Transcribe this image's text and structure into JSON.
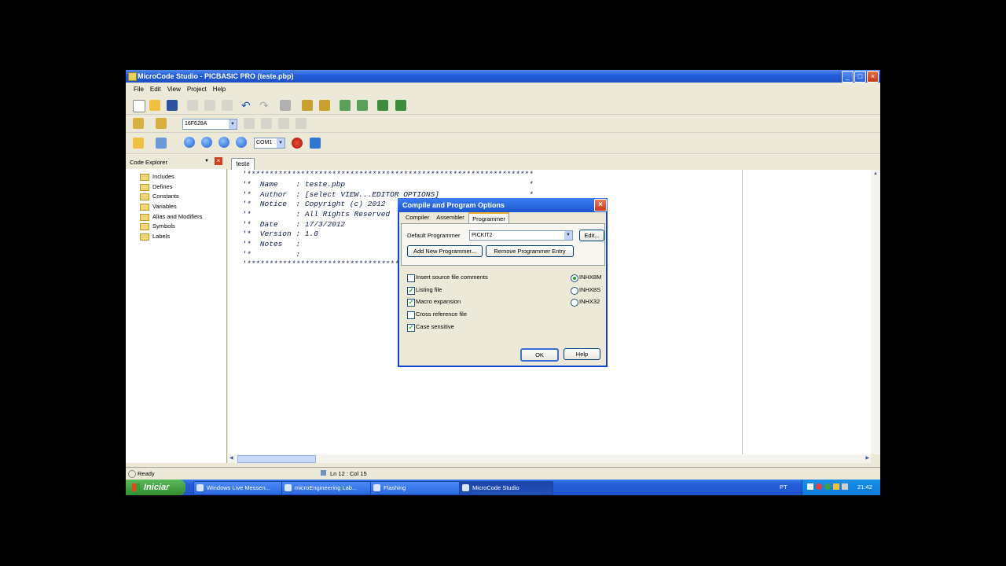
{
  "window": {
    "title": "MicroCode Studio - PICBASIC PRO (teste.pbp)"
  },
  "menu": [
    "File",
    "Edit",
    "View",
    "Project",
    "Help"
  ],
  "toolbar": {
    "device": "16F628A",
    "port": "COM1"
  },
  "explorer": {
    "title": "Code Explorer",
    "items": [
      "Includes",
      "Defines",
      "Constants",
      "Variables",
      "Alias and Modifiers",
      "Symbols",
      "Labels"
    ]
  },
  "editor": {
    "tab": "teste",
    "lines": [
      "'****************************************************************",
      "'*  Name    : teste.pbp                                         *",
      "'*  Author  : [select VIEW...EDITOR OPTIONS]                    *",
      "'*  Notice  : Copyright (c) 2012                               *",
      "'*          : All Rights Reserved                              *",
      "'*  Date    : 17/3/2012                                        *",
      "'*  Version : 1.0                                              *",
      "'*  Notes   :                                                  *",
      "'*          :                                                  *",
      "'****************************************************************"
    ]
  },
  "status": {
    "ready": "Ready",
    "position": "Ln 12 : Col 15"
  },
  "dialog": {
    "title": "Compile and Program Options",
    "tabs": [
      "Compiler",
      "Assembler",
      "Programmer"
    ],
    "default_programmer_label": "Default Programmer",
    "default_programmer_value": "PICKIT2",
    "edit_button": "Edit...",
    "add_button": "Add New Programmer...",
    "remove_button": "Remove Programmer Entry",
    "checkboxes": [
      {
        "label": "Insert source file comments",
        "checked": false
      },
      {
        "label": "Listing file",
        "checked": true
      },
      {
        "label": "Macro expansion",
        "checked": true
      },
      {
        "label": "Cross reference file",
        "checked": false
      },
      {
        "label": "Case sensitive",
        "checked": true
      }
    ],
    "radios": [
      {
        "label": "INHX8M",
        "selected": true
      },
      {
        "label": "INHX8S",
        "selected": false
      },
      {
        "label": "INHX32",
        "selected": false
      }
    ],
    "ok": "OK",
    "help": "Help"
  },
  "taskbar": {
    "start": "Iniciar",
    "items": [
      "Windows Live Messen...",
      "microEngineering Lab...",
      "Flashing",
      "MicroCode Studio"
    ],
    "lang": "PT",
    "clock": "21:42"
  },
  "colors": {
    "titlebar": "#245edb",
    "taskbar": "#245edb",
    "start": "#3c9c3c",
    "dialog_border": "#0a46c8"
  }
}
